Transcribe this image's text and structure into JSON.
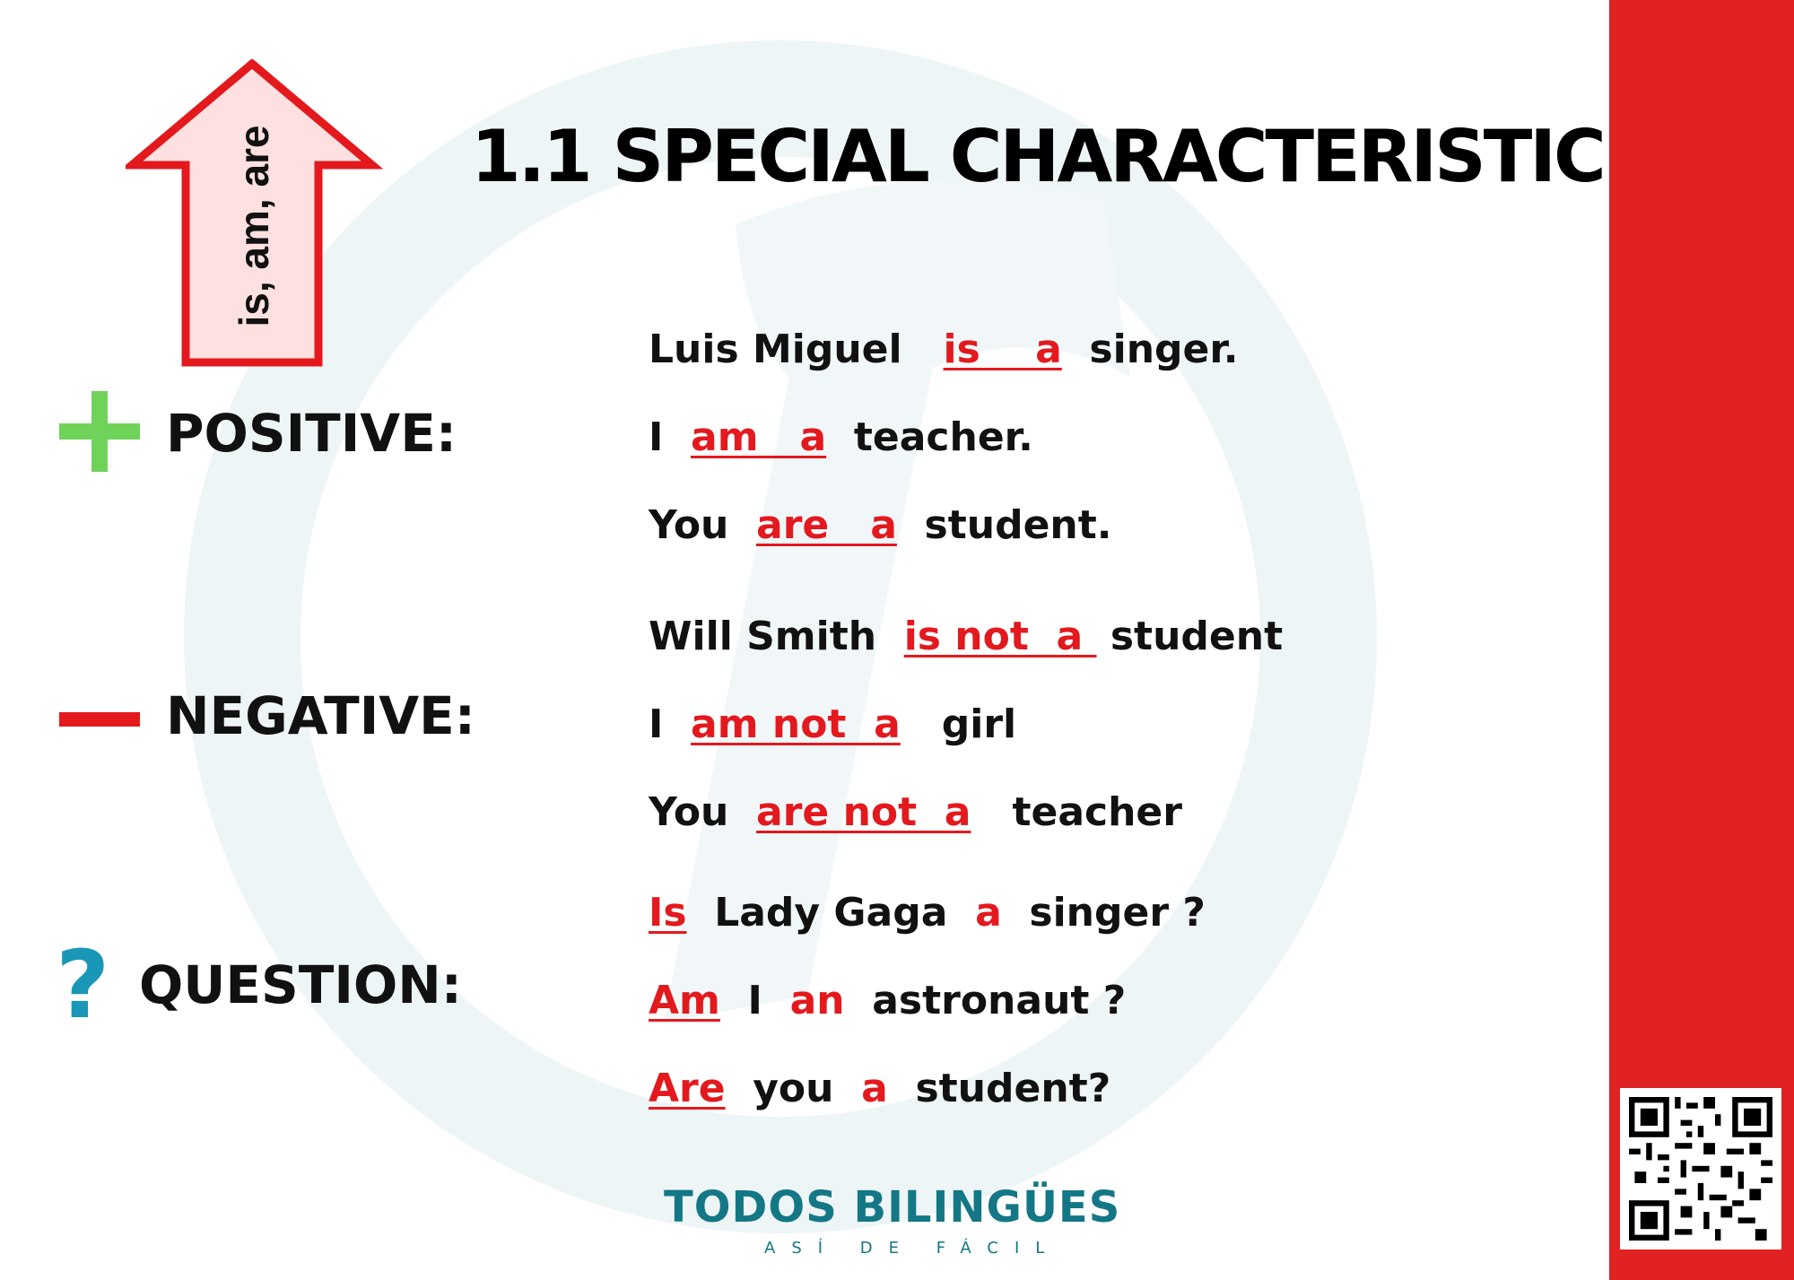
{
  "arrow_label": "is, am, are",
  "title": "1.1 SPECIAL CHARACTERISTIC",
  "sections": {
    "positive": "POSITIVE:",
    "negative": "NEGATIVE:",
    "question": "QUESTION:"
  },
  "positive": [
    [
      "Luis Miguel   ",
      "is    a",
      "  singer."
    ],
    [
      "I  ",
      "am   a",
      "  teacher."
    ],
    [
      "You  ",
      "are   a",
      "  student."
    ]
  ],
  "negative": [
    [
      "Will Smith  ",
      "is not  a ",
      " student"
    ],
    [
      "I  ",
      "am not  a",
      "   girl"
    ],
    [
      "You  ",
      "are not  a",
      "   teacher"
    ]
  ],
  "question": [
    [
      "Is",
      "  Lady Gaga  ",
      "a",
      "  singer ?"
    ],
    [
      "Am",
      "  I  ",
      "an",
      "  astronaut ?"
    ],
    [
      "Are",
      "  you  ",
      "a",
      "  student?"
    ]
  ],
  "brand": {
    "name": "TODOS BILINGÜES",
    "tagline": "ASÍ DE FÁCIL"
  },
  "colors": {
    "accent_red": "#e3191e",
    "side_bar": "#e02224",
    "plus_green": "#6fd35a",
    "question_blue": "#1a97b6",
    "brand_teal": "#137786"
  },
  "icons": [
    "arrow-up-icon",
    "plus-icon",
    "minus-icon",
    "question-mark-icon",
    "qr-code-icon",
    "watermark-logo"
  ]
}
